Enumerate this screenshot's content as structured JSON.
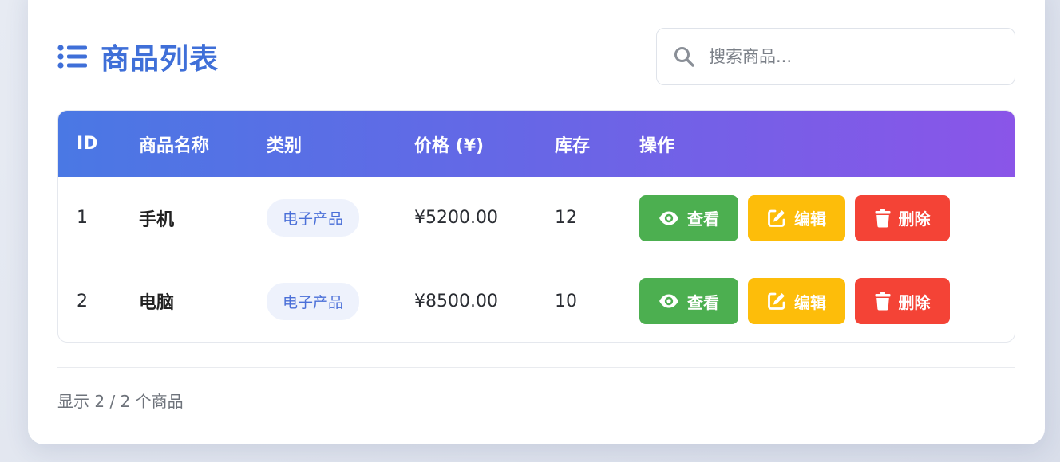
{
  "header": {
    "title": "商品列表",
    "icon": "list-icon",
    "title_color": "#3f6fd8"
  },
  "search": {
    "placeholder": "搜索商品...",
    "value": "",
    "icon": "search-icon"
  },
  "table": {
    "columns": [
      "ID",
      "商品名称",
      "类别",
      "价格 (¥)",
      "库存",
      "操作"
    ],
    "rows": [
      {
        "id": "1",
        "name": "手机",
        "category": "电子产品",
        "price": "¥5200.00",
        "stock": "12"
      },
      {
        "id": "2",
        "name": "电脑",
        "category": "电子产品",
        "price": "¥8500.00",
        "stock": "10"
      }
    ],
    "actions": {
      "view_label": "查看",
      "edit_label": "编辑",
      "delete_label": "删除",
      "view_icon": "eye-icon",
      "edit_icon": "edit-icon",
      "delete_icon": "trash-icon"
    },
    "header_gradient": [
      "#4a78e4",
      "#8a55e8"
    ],
    "colors": {
      "view": "#4caf50",
      "edit": "#fdbd0a",
      "delete": "#f44336",
      "badge_bg": "#eef2fc",
      "badge_text": "#4a6fd8"
    }
  },
  "footer": {
    "summary": "显示 2 / 2 个商品"
  }
}
